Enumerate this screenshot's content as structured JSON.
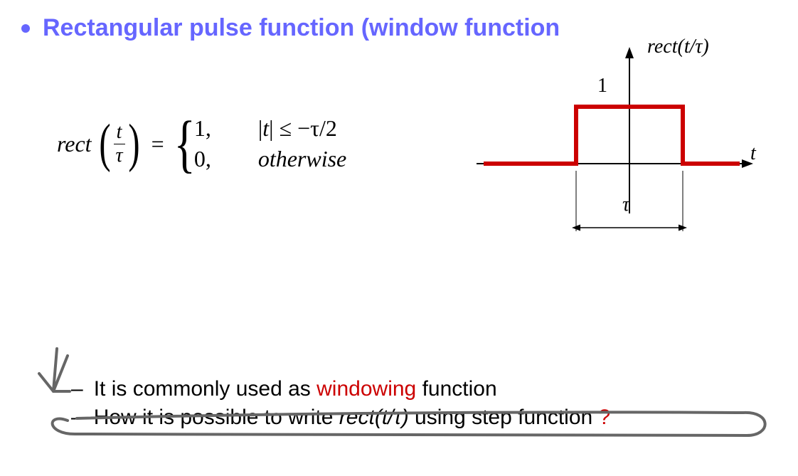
{
  "heading": "Rectangular pulse function (window function",
  "equation": {
    "lhs_func": "rect",
    "lhs_frac_top": "t",
    "lhs_frac_bot": "τ",
    "equals": "=",
    "case1_val": "1,",
    "case1_cond_abs_var": "t",
    "case1_cond": "|t| ≤ −τ/2",
    "case2_val": "0,",
    "case2_cond": "otherwise"
  },
  "plot": {
    "y_label": "rect(t/τ)",
    "top_tick": "1",
    "x_axis_label": "t",
    "width_label": "τ"
  },
  "list": {
    "line1_prefix": "It is commonly used as ",
    "line1_highlight": "windowing",
    "line1_suffix": " function",
    "line2_prefix": "How it is possible to write ",
    "line2_italic": "rect(t/τ)",
    "line2_suffix": " using step function ",
    "line2_mark": "?"
  },
  "chart_data": {
    "type": "line",
    "title": "rect(t/τ)",
    "xlabel": "t",
    "ylabel": "rect(t/τ)",
    "x": [
      -1.5,
      -0.5,
      -0.5,
      0.5,
      0.5,
      1.5
    ],
    "y": [
      0,
      0,
      1,
      1,
      0,
      0
    ],
    "x_units": "τ",
    "ylim": [
      0,
      1
    ],
    "width_annotation": "τ",
    "yticks": [
      1
    ]
  }
}
